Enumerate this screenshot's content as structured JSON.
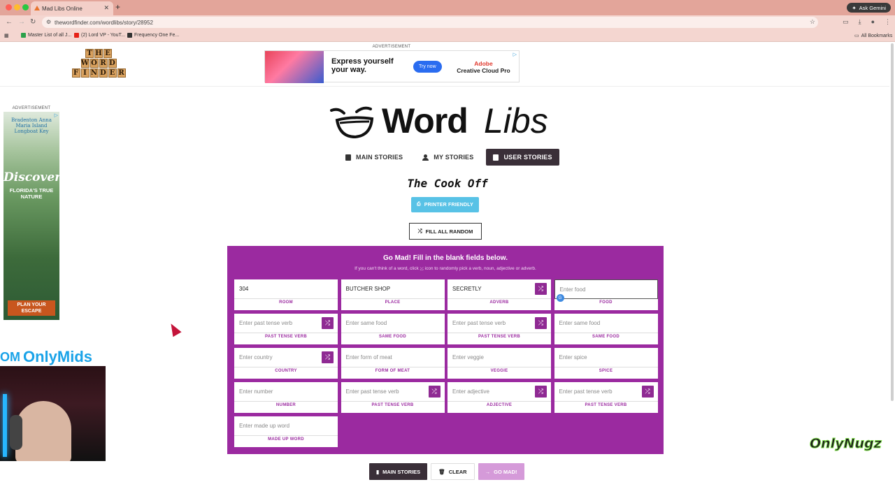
{
  "browser": {
    "tab_title": "Mad Libs Online",
    "url": "thewordfinder.com/wordlibs/story/28952",
    "ask_label": "Ask Gemini",
    "bookmarks": [
      "Master List of all J...",
      "(2) Lord VP - YouT...",
      "Frequency One Fe..."
    ],
    "all_bookmarks": "All Bookmarks"
  },
  "site": {
    "logo_rows": [
      "THE",
      "WORD",
      "FINDER"
    ],
    "ad_label": "ADVERTISEMENT"
  },
  "top_ad": {
    "headline": "Express yourself your way.",
    "cta": "Try now",
    "brand_line1": "Adobe",
    "brand_line2": "Creative Cloud Pro"
  },
  "side_ad": {
    "brand": "Bradenton Anna Maria Island Longboat Key",
    "discover": "Discover",
    "tagline": "FLORIDA'S TRUE NATURE",
    "cta": "PLAN YOUR ESCAPE"
  },
  "overlay": {
    "onlymids": "OnlyMids",
    "onlynugz": "OnlyNugz"
  },
  "wordlibs": {
    "logo_word": "Word",
    "logo_libs": "Libs",
    "nav": [
      {
        "label": "MAIN STORIES"
      },
      {
        "label": "MY STORIES"
      },
      {
        "label": "USER STORIES",
        "active": true
      }
    ],
    "story_title": "The Cook Off",
    "printer_label": "PRINTER FRIENDLY",
    "fill_random_label": "FILL ALL RANDOM"
  },
  "form": {
    "title": "Go Mad! Fill in the blank fields below.",
    "subtitle": "If you can't think of a word, click ⤩ icon to randomly pick a verb, noun, adjective or adverb.",
    "fields": [
      {
        "value": "304",
        "placeholder": "",
        "label": "ROOM",
        "random": false
      },
      {
        "value": "BUTCHER SHOP",
        "placeholder": "",
        "label": "PLACE",
        "random": false
      },
      {
        "value": "SECRETLY",
        "placeholder": "",
        "label": "ADVERB",
        "random": true
      },
      {
        "value": "",
        "placeholder": "Enter food",
        "label": "FOOD",
        "random": false
      },
      {
        "value": "",
        "placeholder": "Enter past tense verb",
        "label": "PAST TENSE VERB",
        "random": true
      },
      {
        "value": "",
        "placeholder": "Enter same food",
        "label": "SAME FOOD",
        "random": false
      },
      {
        "value": "",
        "placeholder": "Enter past tense verb",
        "label": "PAST TENSE VERB",
        "random": true
      },
      {
        "value": "",
        "placeholder": "Enter same food",
        "label": "SAME FOOD",
        "random": false
      },
      {
        "value": "",
        "placeholder": "Enter country",
        "label": "COUNTRY",
        "random": true
      },
      {
        "value": "",
        "placeholder": "Enter form of meat",
        "label": "FORM OF MEAT",
        "random": false
      },
      {
        "value": "",
        "placeholder": "Enter veggie",
        "label": "VEGGIE",
        "random": false
      },
      {
        "value": "",
        "placeholder": "Enter spice",
        "label": "SPICE",
        "random": false
      },
      {
        "value": "",
        "placeholder": "Enter number",
        "label": "NUMBER",
        "random": false
      },
      {
        "value": "",
        "placeholder": "Enter past tense verb",
        "label": "PAST TENSE VERB",
        "random": true
      },
      {
        "value": "",
        "placeholder": "Enter adjective",
        "label": "ADJECTIVE",
        "random": true
      },
      {
        "value": "",
        "placeholder": "Enter past tense verb",
        "label": "PAST TENSE VERB",
        "random": true
      },
      {
        "value": "",
        "placeholder": "Enter made up word",
        "label": "MADE UP WORD",
        "random": false
      }
    ]
  },
  "bottom": {
    "main_stories": "MAIN STORIES",
    "clear": "CLEAR",
    "go_mad": "GO MAD!"
  }
}
